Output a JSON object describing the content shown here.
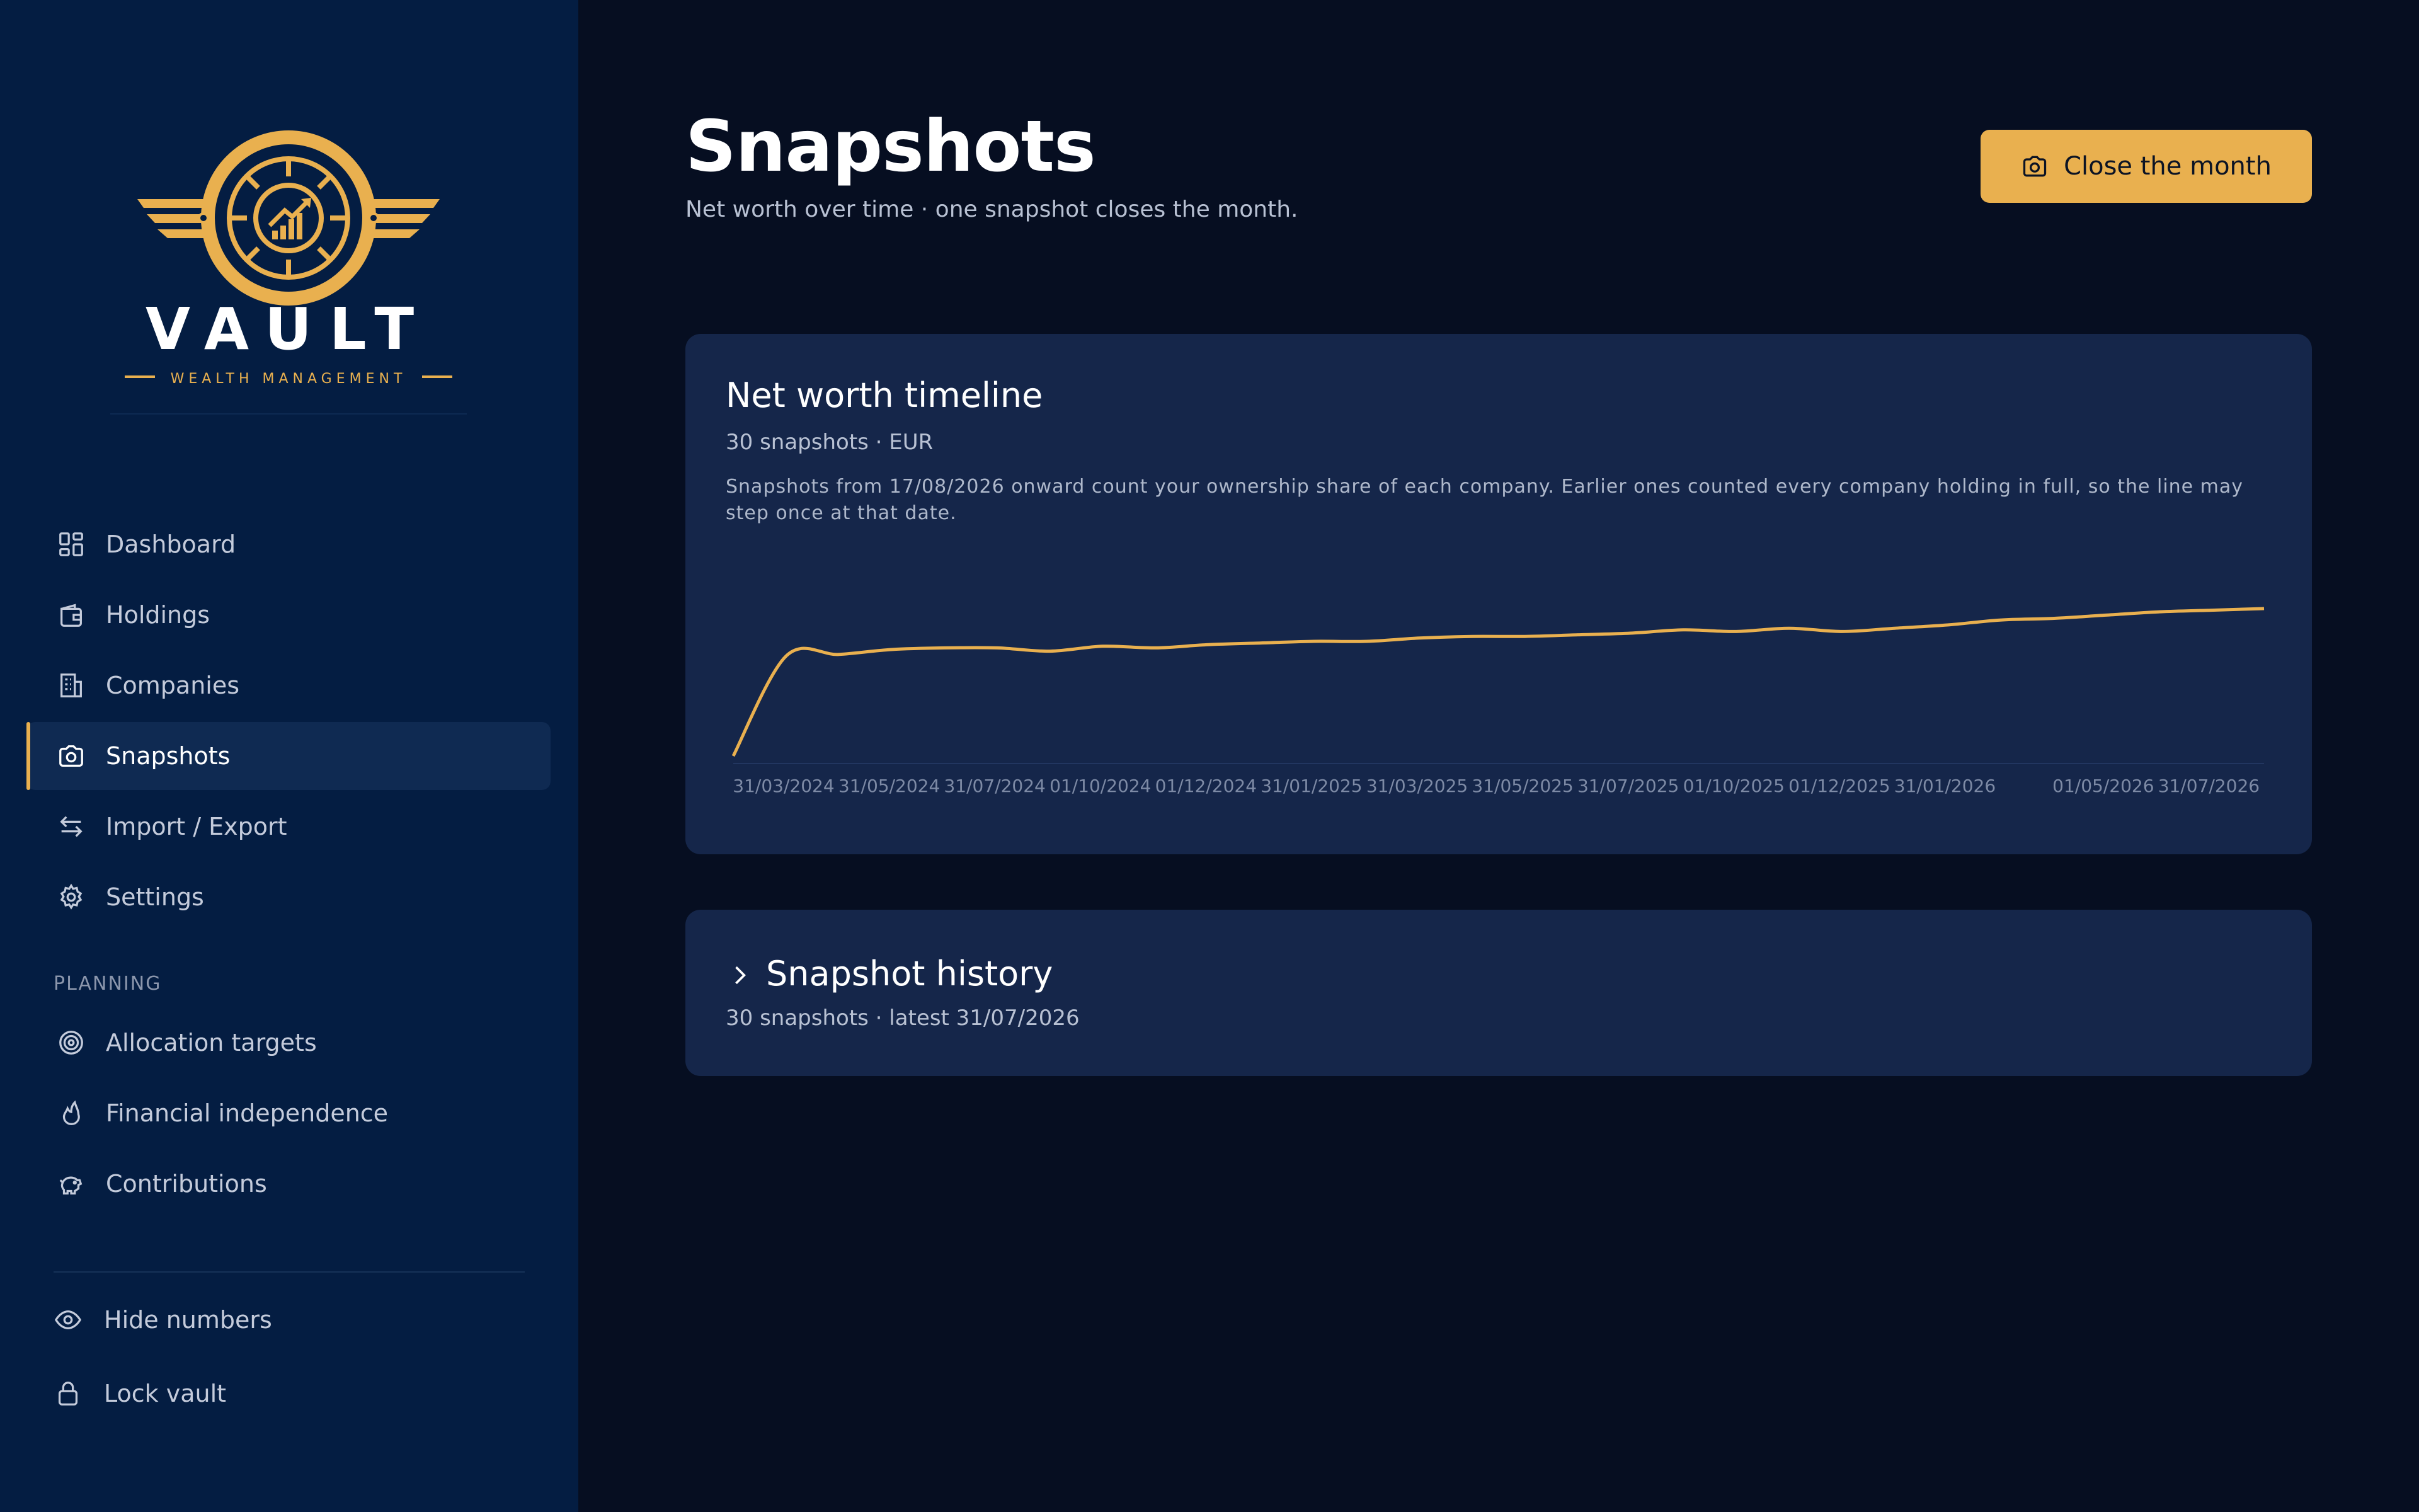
{
  "brand": {
    "name": "VAULT",
    "tagline": "WEALTH MANAGEMENT",
    "accent": "#e9b04f"
  },
  "sidebar": {
    "items": [
      {
        "label": "Dashboard",
        "icon": "dashboard-icon"
      },
      {
        "label": "Holdings",
        "icon": "wallet-icon"
      },
      {
        "label": "Companies",
        "icon": "building-icon"
      },
      {
        "label": "Snapshots",
        "icon": "camera-icon",
        "active": true
      },
      {
        "label": "Import / Export",
        "icon": "swap-arrows-icon"
      },
      {
        "label": "Settings",
        "icon": "gear-icon"
      }
    ],
    "section_label": "PLANNING",
    "planning_items": [
      {
        "label": "Allocation targets",
        "icon": "target-icon"
      },
      {
        "label": "Financial independence",
        "icon": "flame-icon"
      },
      {
        "label": "Contributions",
        "icon": "piggy-bank-icon"
      }
    ],
    "utility_items": [
      {
        "label": "Hide numbers",
        "icon": "eye-icon"
      },
      {
        "label": "Lock vault",
        "icon": "lock-icon"
      }
    ]
  },
  "header": {
    "title": "Snapshots",
    "subtitle": "Net worth over time · one snapshot closes the month.",
    "close_button_label": "Close the month"
  },
  "timeline_card": {
    "title": "Net worth timeline",
    "meta": "30 snapshots · EUR",
    "note": "Snapshots from 17/08/2026 onward count your ownership share of each company. Earlier ones counted every company holding in full, so the line may step once at that date."
  },
  "history_card": {
    "title": "Snapshot history",
    "meta": "30 snapshots · latest 31/07/2026"
  },
  "chart_data": {
    "type": "line",
    "title": "",
    "xlabel": "",
    "ylabel": "",
    "y_axis_visible": false,
    "line_color": "#e9b04f",
    "x_tick_labels": [
      "31/03/2024",
      "31/05/2024",
      "31/07/2024",
      "01/10/2024",
      "01/12/2024",
      "31/01/2025",
      "31/03/2025",
      "31/05/2025",
      "31/07/2025",
      "01/10/2025",
      "01/12/2025",
      "31/01/2026",
      "01/05/2026",
      "31/07/2026"
    ],
    "x_tick_index": [
      0,
      2,
      4,
      6,
      8,
      10,
      12,
      14,
      16,
      18,
      20,
      22,
      25,
      27
    ],
    "series": [
      {
        "values": [
          0,
          61,
          62,
          65,
          66,
          66,
          64,
          67,
          66,
          68,
          69,
          70,
          70,
          72,
          73,
          73,
          74,
          75,
          77,
          76,
          78,
          76,
          78,
          80,
          83,
          84,
          86,
          88,
          89,
          90
        ]
      }
    ]
  }
}
